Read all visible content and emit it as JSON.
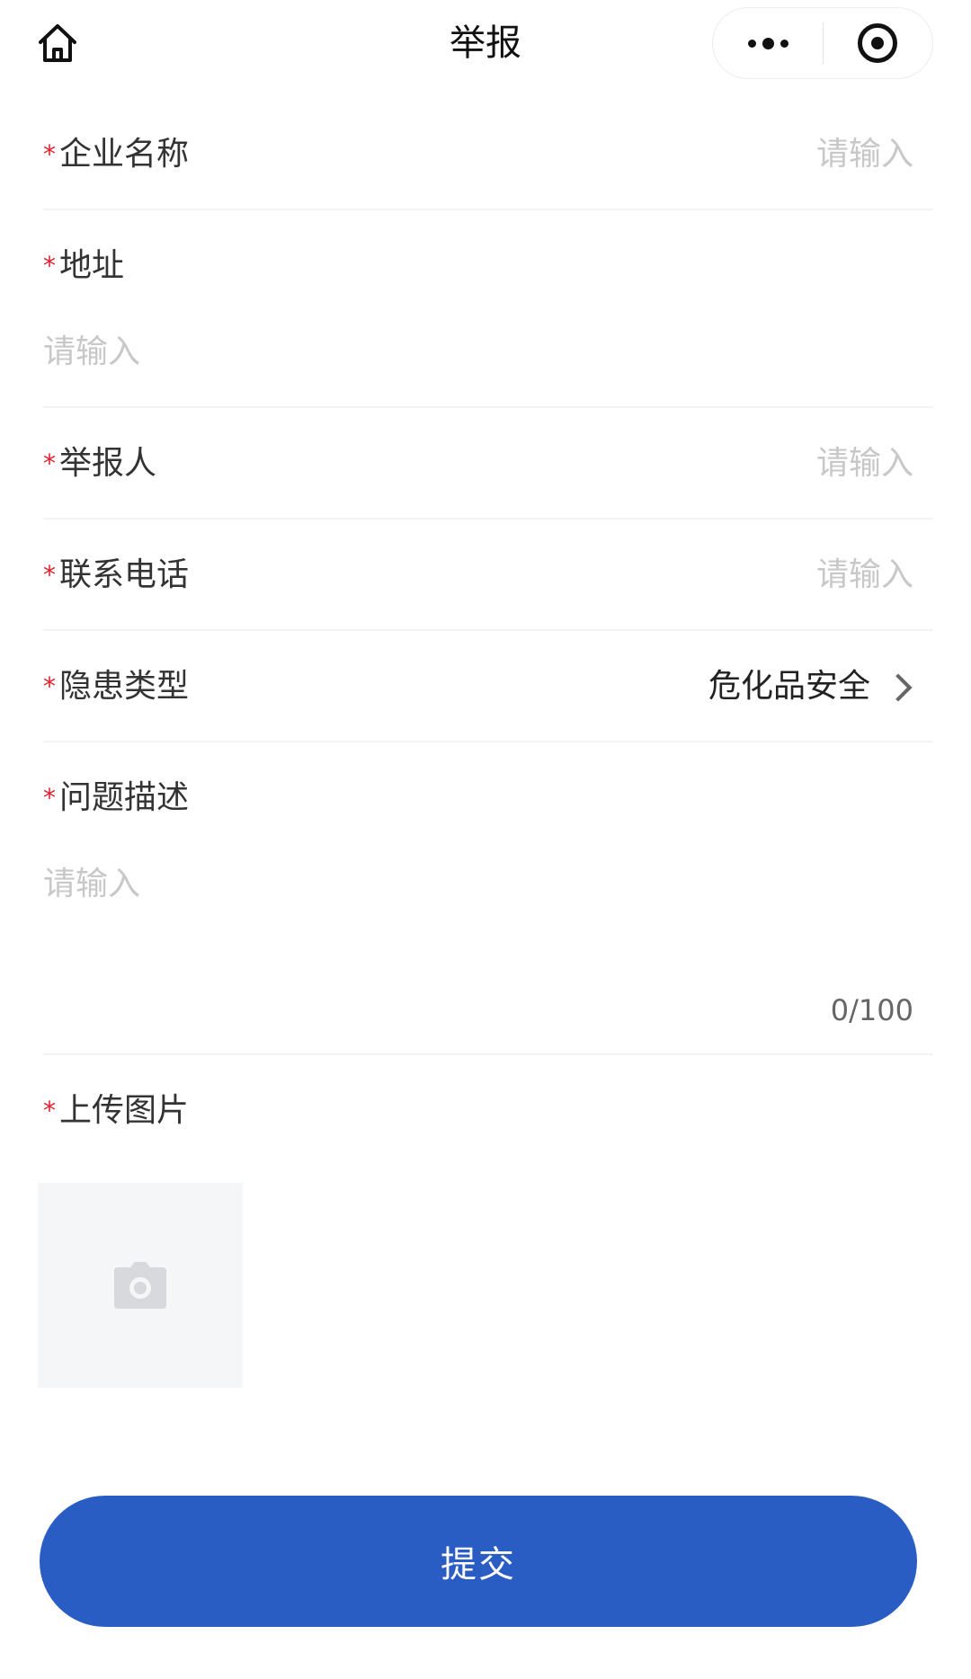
{
  "navbar": {
    "title": "举报",
    "home_icon": "home-icon",
    "more_icon": "more-dots-icon",
    "close_icon": "target-circle-icon"
  },
  "form": {
    "company": {
      "required_mark": "*",
      "label": "企业名称",
      "placeholder": "请输入"
    },
    "address": {
      "required_mark": "*",
      "label": "地址",
      "placeholder": "请输入"
    },
    "reporter": {
      "required_mark": "*",
      "label": "举报人",
      "placeholder": "请输入"
    },
    "phone": {
      "required_mark": "*",
      "label": "联系电话",
      "placeholder": "请输入"
    },
    "hazard_type": {
      "required_mark": "*",
      "label": "隐患类型",
      "value": "危化品安全"
    },
    "description": {
      "required_mark": "*",
      "label": "问题描述",
      "placeholder": "请输入",
      "counter": "0/100"
    },
    "upload": {
      "required_mark": "*",
      "label": "上传图片",
      "icon": "camera-icon"
    }
  },
  "submit": {
    "label": "提交"
  },
  "colors": {
    "primary": "#2a5dc4",
    "required": "#e0202f",
    "placeholder": "#c8c8c8"
  }
}
